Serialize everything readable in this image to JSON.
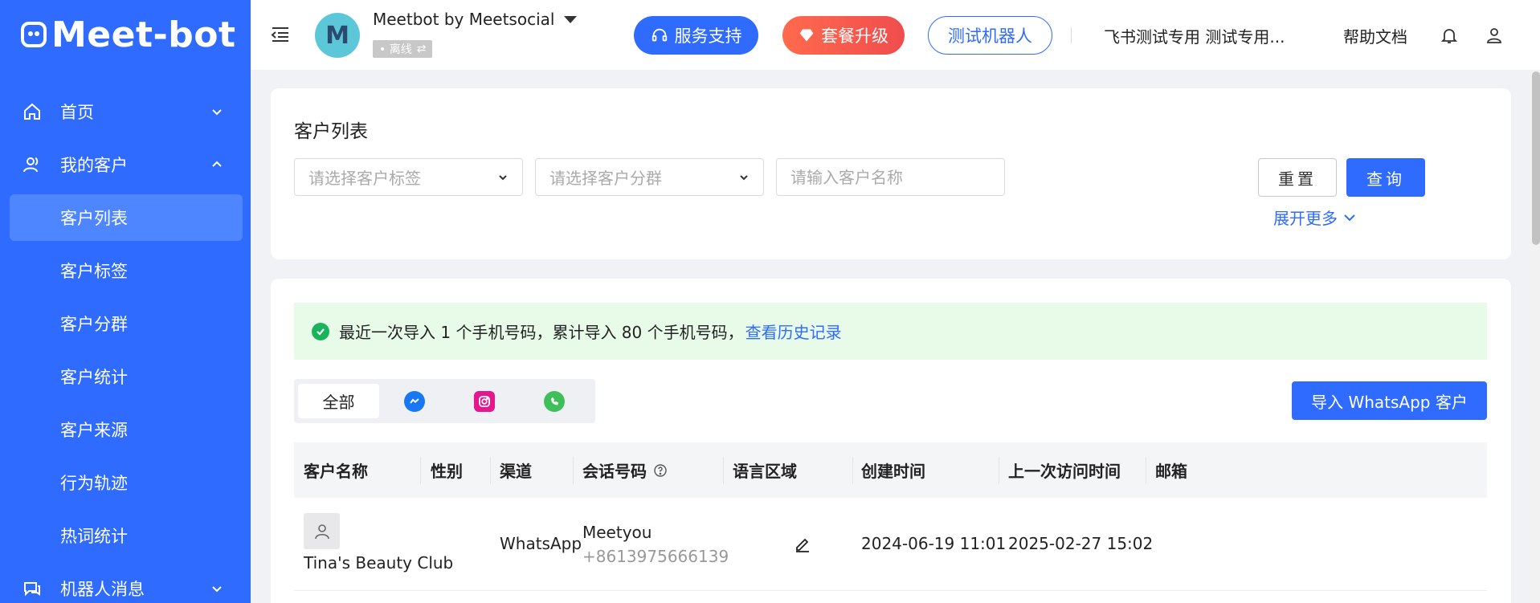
{
  "app": {
    "logo_text": "Meet-bot"
  },
  "sidebar": {
    "items": [
      {
        "label": "首页",
        "icon": "home-icon",
        "expanded": false
      },
      {
        "label": "我的客户",
        "icon": "users-icon",
        "expanded": true
      },
      {
        "label": "机器人消息",
        "icon": "message-icon",
        "expanded": false
      }
    ],
    "sub_items": [
      "客户列表",
      "客户标签",
      "客户分群",
      "客户统计",
      "客户来源",
      "行为轨迹",
      "热词统计"
    ],
    "active_sub": "客户列表"
  },
  "header": {
    "avatar_letter": "M",
    "account_name": "Meetbot by Meetsocial",
    "status": "• 离线",
    "support_label": "服务支持",
    "upgrade_label": "套餐升级",
    "test_bot_label": "测试机器人",
    "workspace": "飞书测试专用  测试专用...",
    "help_label": "帮助文档"
  },
  "filter": {
    "title": "客户列表",
    "tag_placeholder": "请选择客户标签",
    "group_placeholder": "请选择客户分群",
    "name_placeholder": "请输入客户名称",
    "reset_label": "重置",
    "query_label": "查询",
    "expand_label": "展开更多"
  },
  "notice": {
    "text": "最近一次导入 1 个手机号码，累计导入 80 个手机号码，",
    "link": "查看历史记录"
  },
  "channel_tabs": {
    "all_label": "全部",
    "icons": [
      "messenger-icon",
      "instagram-icon",
      "whatsapp-icon"
    ]
  },
  "import_label": "导入 WhatsApp 客户",
  "table": {
    "columns": [
      "客户名称",
      "性别",
      "渠道",
      "会话号码",
      "语言区域",
      "创建时间",
      "上一次访问时间",
      "邮箱"
    ],
    "rows": [
      {
        "name": "Tina's Beauty Club",
        "gender": "",
        "channel": "WhatsApp",
        "session_name": "Meetyou",
        "session_phone": "+8613975666139",
        "locale": "",
        "created": "2024-06-19 11:01",
        "last_visit": "2025-02-27 15:02",
        "email": ""
      }
    ]
  },
  "colors": {
    "primary": "#2f6bff",
    "sidebar": "#2f6bff",
    "upgrade": "#f04d4d",
    "notice_bg": "#e7fbe8",
    "success": "#18b35a"
  }
}
